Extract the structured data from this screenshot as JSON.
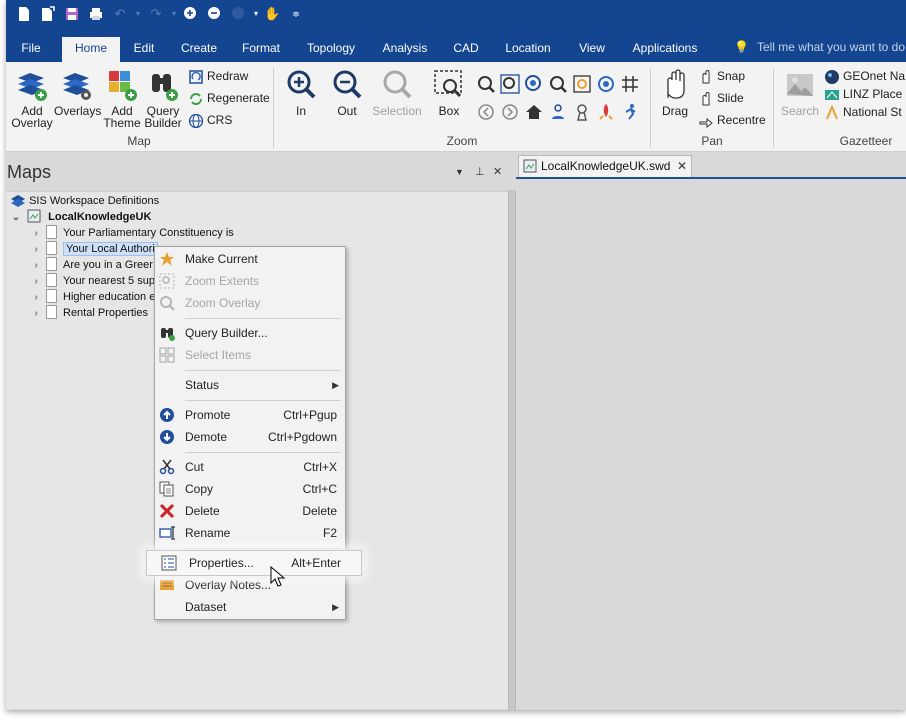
{
  "quick_access": {
    "icons": [
      "new-icon",
      "new-workspace-icon",
      "save-icon",
      "print-icon",
      "undo-icon",
      "redo-icon",
      "add-icon",
      "remove-icon",
      "circle-icon",
      "pan-hand-icon",
      "customize-icon"
    ]
  },
  "tabs": [
    {
      "label": "File"
    },
    {
      "label": "Home",
      "active": true
    },
    {
      "label": "Edit"
    },
    {
      "label": "Create"
    },
    {
      "label": "Format"
    },
    {
      "label": "Topology"
    },
    {
      "label": "Analysis"
    },
    {
      "label": "CAD"
    },
    {
      "label": "Location"
    },
    {
      "label": "View"
    },
    {
      "label": "Applications"
    }
  ],
  "tell_me": "Tell me what you want to do",
  "ribbon": {
    "map_group": {
      "label": "Map",
      "add_overlay": "Add\nOverlay",
      "add_overlay_l1": "Add",
      "add_overlay_l2": "Overlay",
      "overlays": "Overlays",
      "add_theme_l1": "Add",
      "add_theme_l2": "Theme",
      "query_builder_l1": "Query",
      "query_builder_l2": "Builder",
      "redraw": "Redraw",
      "regenerate": "Regenerate",
      "crs": "CRS"
    },
    "zoom_group": {
      "label": "Zoom",
      "in": "In",
      "out": "Out",
      "selection": "Selection",
      "box": "Box"
    },
    "pan_group": {
      "label": "Pan",
      "drag": "Drag",
      "snap": "Snap",
      "slide": "Slide",
      "recentre": "Recentre"
    },
    "gazetteer_group": {
      "label": "Gazetteer",
      "search": "Search",
      "items": [
        "GEOnet Na",
        "LINZ Place",
        "National St"
      ]
    }
  },
  "maps_panel": {
    "title": "Maps",
    "tree": {
      "root": "SIS Workspace Definitions",
      "workspace": "LocalKnowledgeUK",
      "items": [
        {
          "label": "Your Parliamentary Constituency is"
        },
        {
          "label": "Your Local Authori",
          "selected": true
        },
        {
          "label": "Are you in a Greer"
        },
        {
          "label": "Your nearest 5 sup"
        },
        {
          "label": "Higher education e"
        },
        {
          "label": "Rental Properties"
        }
      ]
    }
  },
  "document_tab": {
    "name": "LocalKnowledgeUK.swd",
    "close": "✕"
  },
  "context_menu": {
    "items": [
      {
        "label": "Make Current",
        "shortcut": "",
        "icon": "star-icon",
        "enabled": true
      },
      {
        "label": "Zoom Extents",
        "shortcut": "",
        "icon": "zoom-extents-icon",
        "enabled": false
      },
      {
        "label": "Zoom Overlay",
        "shortcut": "",
        "icon": "zoom-overlay-icon",
        "enabled": false
      },
      {
        "label": "Query Builder...",
        "shortcut": "",
        "icon": "binoculars-icon",
        "enabled": true
      },
      {
        "label": "Select Items",
        "shortcut": "",
        "icon": "select-items-icon",
        "enabled": false
      },
      {
        "label": "Status",
        "shortcut": "",
        "icon": "",
        "enabled": true,
        "submenu": true
      },
      {
        "label": "Promote",
        "shortcut": "Ctrl+Pgup",
        "icon": "arrow-up-circle-icon",
        "enabled": true
      },
      {
        "label": "Demote",
        "shortcut": "Ctrl+Pgdown",
        "icon": "arrow-down-circle-icon",
        "enabled": true
      },
      {
        "label": "Cut",
        "shortcut": "Ctrl+X",
        "icon": "scissors-icon",
        "enabled": true
      },
      {
        "label": "Copy",
        "shortcut": "Ctrl+C",
        "icon": "copy-icon",
        "enabled": true
      },
      {
        "label": "Delete",
        "shortcut": "Delete",
        "icon": "delete-x-icon",
        "enabled": true
      },
      {
        "label": "Rename",
        "shortcut": "F2",
        "icon": "rename-icon",
        "enabled": true
      },
      {
        "label": "Properties...",
        "shortcut": "Alt+Enter",
        "icon": "properties-icon",
        "enabled": true,
        "highlighted": true
      },
      {
        "label": "Overlay Notes...",
        "shortcut": "",
        "icon": "notes-icon",
        "enabled": true
      },
      {
        "label": "Dataset",
        "shortcut": "",
        "icon": "",
        "enabled": true,
        "submenu": true
      }
    ]
  },
  "colors": {
    "ribbon_blue": "#134591",
    "accent_orange": "#e8a030",
    "delete_red": "#d02020"
  }
}
